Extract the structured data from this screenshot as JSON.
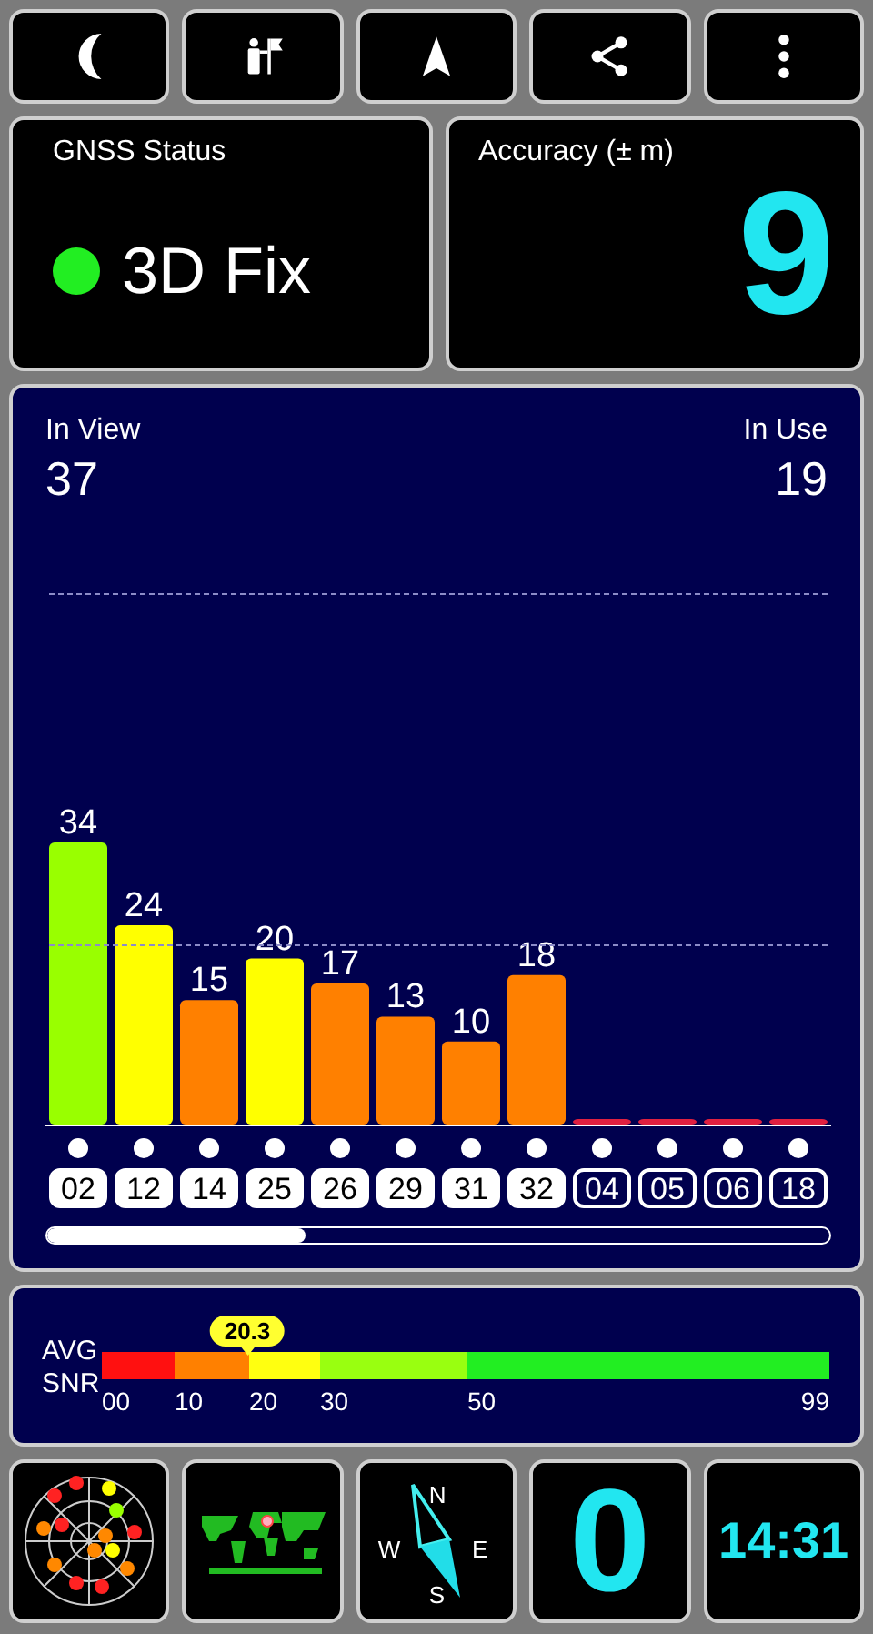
{
  "toolbar": {
    "buttons": [
      {
        "kind": "moon"
      },
      {
        "kind": "person-flag"
      },
      {
        "kind": "navigation"
      },
      {
        "kind": "share"
      },
      {
        "kind": "more"
      }
    ]
  },
  "gnss_status": {
    "title": "GNSS Status",
    "value": "3D Fix",
    "color": "#22ee22"
  },
  "accuracy": {
    "title": "Accuracy (± m)",
    "value": "9"
  },
  "satellites": {
    "in_view_label": "In View",
    "in_view": "37",
    "in_use_label": "In Use",
    "in_use": "19",
    "chart_data": {
      "type": "bar",
      "categories": [
        "02",
        "12",
        "14",
        "25",
        "26",
        "29",
        "31",
        "32",
        "04",
        "05",
        "06",
        "18"
      ],
      "values": [
        34,
        24,
        15,
        20,
        17,
        13,
        10,
        18,
        null,
        null,
        null,
        null
      ],
      "data_labels": true
    },
    "used": [
      true,
      true,
      true,
      true,
      true,
      true,
      true,
      true,
      false,
      false,
      false,
      false
    ]
  },
  "snr": {
    "label_1": "AVG",
    "label_2": "SNR",
    "average": "20.3",
    "ticks": [
      "00",
      "10",
      "20",
      "30",
      "50",
      "99"
    ]
  },
  "tiles": [
    {
      "kind": "skyplot"
    },
    {
      "kind": "map"
    },
    {
      "kind": "compass",
      "n": "N",
      "e": "E",
      "s": "S",
      "w": "W"
    },
    {
      "kind": "digit",
      "value": "0"
    },
    {
      "kind": "clock",
      "value": "14:31"
    }
  ]
}
